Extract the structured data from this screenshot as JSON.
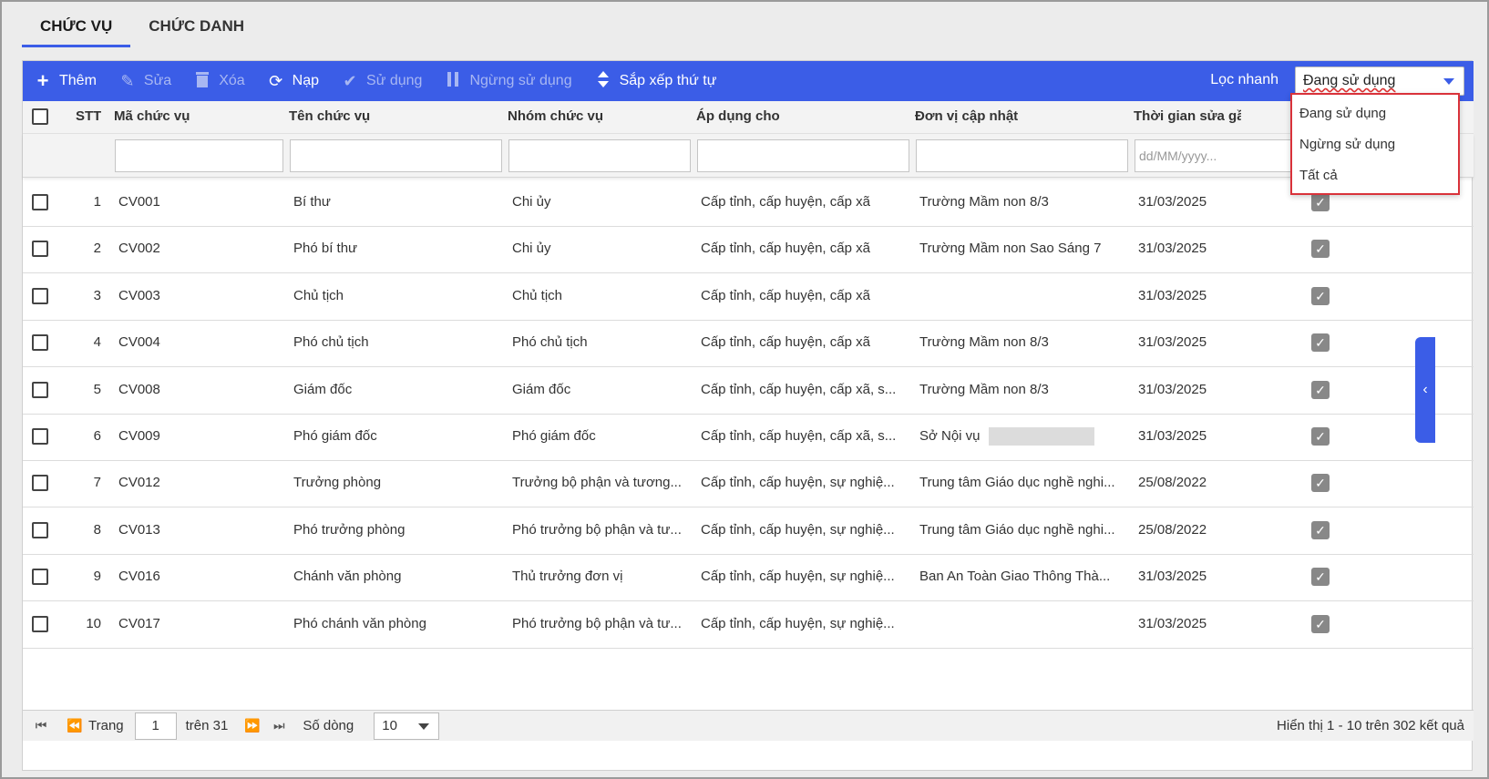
{
  "tabs": [
    {
      "label": "CHỨC VỤ",
      "active": true
    },
    {
      "label": "CHỨC DANH",
      "active": false
    }
  ],
  "toolbar": {
    "add": "Thêm",
    "edit": "Sửa",
    "delete": "Xóa",
    "reload": "Nạp",
    "use": "Sử dụng",
    "stop_use": "Ngừng sử dụng",
    "sort": "Sắp xếp thứ tự",
    "quick_filter_label": "Lọc nhanh",
    "quick_filter_value": "Đang sử dụng"
  },
  "dropdown": {
    "options": [
      "Đang sử dụng",
      "Ngừng sử dụng",
      "Tất cả"
    ]
  },
  "table": {
    "columns": {
      "stt": "STT",
      "code": "Mã chức vụ",
      "name": "Tên chức vụ",
      "group": "Nhóm chức vụ",
      "apply": "Áp dụng cho",
      "unit": "Đơn vị cập nhật",
      "time": "Thời gian sửa gầ"
    },
    "date_placeholder": "dd/MM/yyyy...",
    "rows": [
      {
        "stt": "1",
        "code": "CV001",
        "name": "Bí thư",
        "group": "Chi ủy",
        "apply": "Cấp tỉnh, cấp huyện, cấp xã",
        "unit": "Trường Mầm non 8/3",
        "time": "31/03/2025"
      },
      {
        "stt": "2",
        "code": "CV002",
        "name": "Phó bí thư",
        "group": "Chi ủy",
        "apply": "Cấp tỉnh, cấp huyện, cấp xã",
        "unit": "Trường Mầm non Sao Sáng 7",
        "time": "31/03/2025"
      },
      {
        "stt": "3",
        "code": "CV003",
        "name": "Chủ tịch",
        "group": "Chủ tịch",
        "apply": "Cấp tỉnh, cấp huyện, cấp xã",
        "unit": "",
        "time": "31/03/2025"
      },
      {
        "stt": "4",
        "code": "CV004",
        "name": "Phó chủ tịch",
        "group": "Phó chủ tịch",
        "apply": "Cấp tỉnh, cấp huyện, cấp xã",
        "unit": "Trường Mầm non 8/3",
        "time": "31/03/2025"
      },
      {
        "stt": "5",
        "code": "CV008",
        "name": "Giám đốc",
        "group": "Giám đốc",
        "apply": "Cấp tỉnh, cấp huyện, cấp xã, s...",
        "unit": "Trường Mầm non 8/3",
        "time": "31/03/2025"
      },
      {
        "stt": "6",
        "code": "CV009",
        "name": "Phó giám đốc",
        "group": "Phó giám đốc",
        "apply": "Cấp tỉnh, cấp huyện, cấp xã, s...",
        "unit": "Sở Nội vụ",
        "time": "31/03/2025",
        "redacted": true
      },
      {
        "stt": "7",
        "code": "CV012",
        "name": "Trưởng phòng",
        "group": "Trưởng bộ phận và tương...",
        "apply": "Cấp tỉnh, cấp huyện, sự nghiệ...",
        "unit": "Trung tâm Giáo dục nghề nghi...",
        "time": "25/08/2022"
      },
      {
        "stt": "8",
        "code": "CV013",
        "name": "Phó trưởng phòng",
        "group": "Phó trưởng bộ phận và tư...",
        "apply": "Cấp tỉnh, cấp huyện, sự nghiệ...",
        "unit": "Trung tâm Giáo dục nghề nghi...",
        "time": "25/08/2022"
      },
      {
        "stt": "9",
        "code": "CV016",
        "name": "Chánh văn phòng",
        "group": "Thủ trưởng đơn vị",
        "apply": "Cấp tỉnh, cấp huyện, sự nghiệ...",
        "unit": "Ban An Toàn Giao Thông Thà...",
        "time": "31/03/2025"
      },
      {
        "stt": "10",
        "code": "CV017",
        "name": "Phó chánh văn phòng",
        "group": "Phó trưởng bộ phận và tư...",
        "apply": "Cấp tỉnh, cấp huyện, sự nghiệ...",
        "unit": "",
        "time": "31/03/2025"
      }
    ]
  },
  "pager": {
    "page_label": "Trang",
    "page_value": "1",
    "of_label": "trên 31",
    "rows_label": "Số dòng",
    "rows_value": "10",
    "summary": "Hiển thị 1 - 10 trên 302 kết quả"
  },
  "colors": {
    "accent": "#3b5de7",
    "highlight_border": "#d9323a"
  }
}
